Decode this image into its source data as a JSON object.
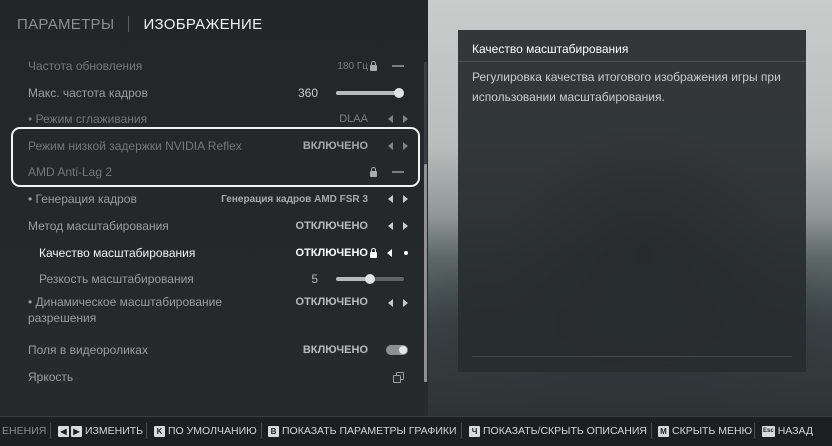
{
  "tabs": [
    {
      "label": "ПАРАМЕТРЫ"
    },
    {
      "label": "ИЗОБРАЖЕНИЕ"
    }
  ],
  "settings": [
    {
      "label": "Частота обновления",
      "value": "180 Гц",
      "control": "locked"
    },
    {
      "label": "Макс. частота кадров",
      "value": "360",
      "control": "slider",
      "level": 1.0
    },
    {
      "label": "• Режим сглаживания",
      "value": "DLAA",
      "control": "arrows"
    },
    {
      "label": "Режим низкой задержки NVIDIA Reflex",
      "value": "ВКЛЮЧЕНО",
      "control": "arrows"
    },
    {
      "label": "AMD Anti-Lag 2",
      "value": "",
      "control": "locked"
    },
    {
      "label": "• Генерация кадров",
      "value": "Генерация кадров AMD FSR 3",
      "control": "arrows"
    },
    {
      "label": "Метод масштабирования",
      "value": "ОТКЛЮЧЕНО",
      "control": "arrows"
    },
    {
      "label": "Качество масштабирования",
      "value": "ОТКЛЮЧЕНО",
      "control": "locked-arrows"
    },
    {
      "label": "Резкость масштабирования",
      "value": "5",
      "control": "slider",
      "level": 0.5
    },
    {
      "label": "• Динамическое масштабирование",
      "label2": "разрешения",
      "value": "ОТКЛЮЧЕНО",
      "control": "arrows"
    },
    {
      "label": "Поля в видеороликах",
      "value": "ВКЛЮЧЕНО",
      "control": "toggle"
    },
    {
      "label": "Яркость",
      "value": "",
      "control": "link"
    }
  ],
  "description": {
    "title": "Качество масштабирования",
    "body": "Регулировка качества итогового изображения игры при использовании масштабирования."
  },
  "hints": [
    {
      "keys": [],
      "label": "ЕНЕНИЯ"
    },
    {
      "keys": [
        "◀",
        "▶"
      ],
      "label": "ИЗМЕНИТЬ"
    },
    {
      "keys": [
        "K"
      ],
      "label": "ПО УМОЛЧАНИЮ"
    },
    {
      "keys": [
        "B"
      ],
      "label": "ПОКАЗАТЬ ПАРАМЕТРЫ ГРАФИКИ"
    },
    {
      "keys": [
        "Ч"
      ],
      "label": "ПОКАЗАТЬ/СКРЫТЬ ОПИСАНИЯ"
    },
    {
      "keys": [
        "M"
      ],
      "label": "СКРЫТЬ МЕНЮ"
    },
    {
      "keys": [
        "Esc"
      ],
      "label": "НАЗАД"
    }
  ],
  "colors": {
    "panel": "#262a2c",
    "text_active": "#ffffff",
    "text_dim": "#74787a",
    "highlight_border": "#f2f2f2"
  },
  "icons": [
    "lock-icon",
    "arrow-left-icon",
    "arrow-right-icon",
    "dash-icon",
    "toggle-icon",
    "copy-icon"
  ]
}
